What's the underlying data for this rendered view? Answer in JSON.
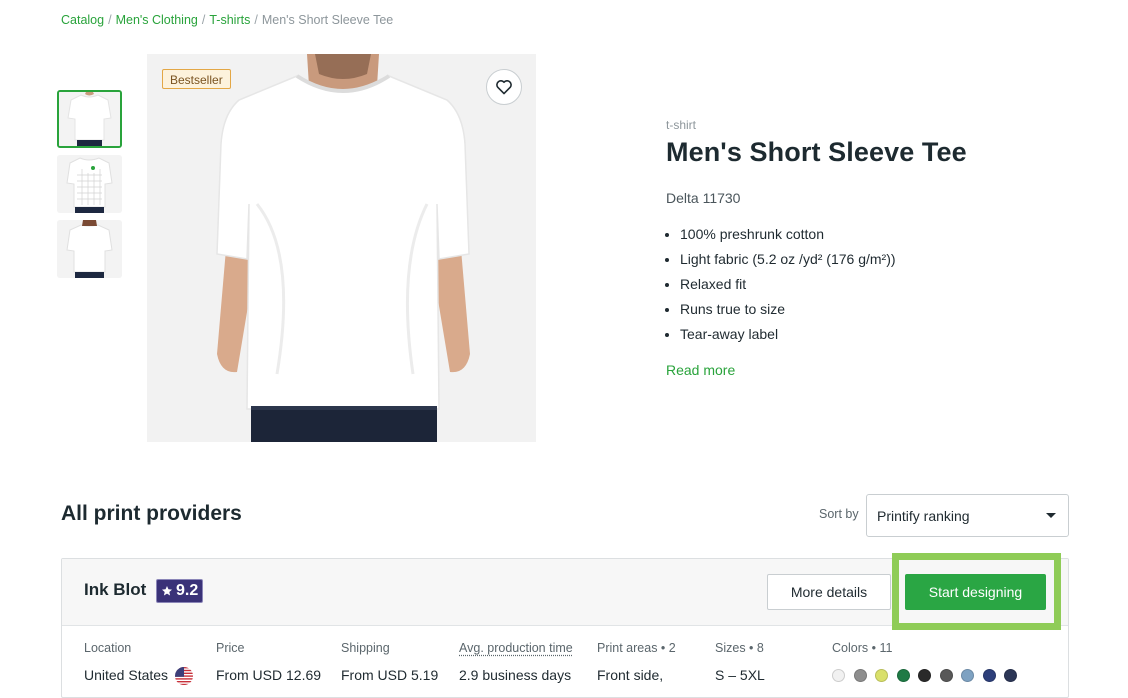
{
  "breadcrumb": {
    "items": [
      "Catalog",
      "Men's Clothing",
      "T-shirts"
    ],
    "current": "Men's Short Sleeve Tee"
  },
  "product": {
    "badge": "Bestseller",
    "type": "t-shirt",
    "title": "Men's Short Sleeve Tee",
    "model": "Delta 11730",
    "features": [
      "100% preshrunk cotton",
      "Light fabric (5.2 oz /yd² (176 g/m²))",
      "Relaxed fit",
      "Runs true to size",
      "Tear-away label"
    ],
    "read_more": "Read more"
  },
  "providers": {
    "title": "All print providers",
    "sort_label": "Sort by",
    "sort_value": "Printify ranking",
    "items": [
      {
        "name": "Ink Blot",
        "rating": "9.2",
        "more_details": "More details",
        "start_designing": "Start designing",
        "columns": [
          {
            "label": "Location",
            "value": "United States"
          },
          {
            "label": "Price",
            "value": "From USD 12.69"
          },
          {
            "label": "Shipping",
            "value": "From USD 5.19"
          },
          {
            "label": "Avg. production time",
            "value": "2.9 business days"
          },
          {
            "label": "Print areas • 2",
            "value": "Front side,"
          },
          {
            "label": "Sizes • 8",
            "value": "S – 5XL"
          },
          {
            "label": "Colors • 11",
            "value": ""
          }
        ],
        "swatch_colors": [
          "#f1f1f1",
          "#8e8e8e",
          "#d9e06a",
          "#1f7a45",
          "#2a2a2a",
          "#585858",
          "#7ea2c2",
          "#2d3f7a",
          "#2c3656"
        ]
      }
    ]
  },
  "colors": {
    "accent_green": "#29a33b",
    "button_green": "#2aa644",
    "rating_purple": "#3a3278",
    "highlight": "#8fcc57"
  }
}
